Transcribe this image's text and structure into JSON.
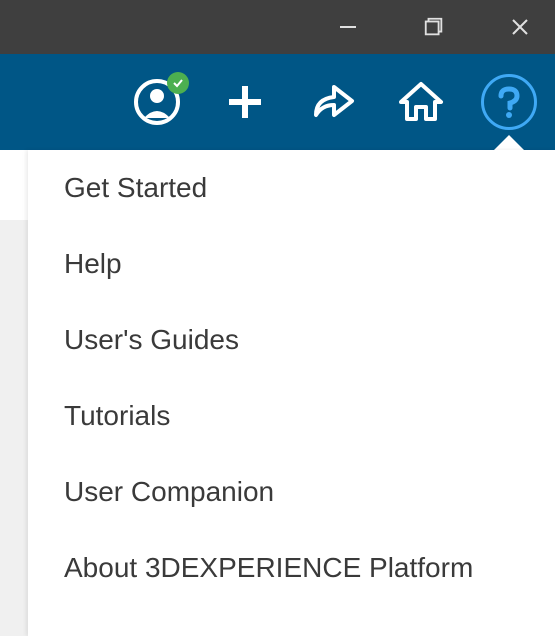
{
  "window_controls": {
    "minimize": "minimize",
    "maximize": "maximize",
    "close": "close"
  },
  "toolbar": {
    "icons": {
      "profile": "profile-icon",
      "status": "online",
      "add": "plus-icon",
      "share": "share-icon",
      "home": "home-icon",
      "help": "help-icon"
    }
  },
  "help_menu": {
    "items": [
      {
        "label": "Get Started"
      },
      {
        "label": "Help"
      },
      {
        "label": "User's Guides"
      },
      {
        "label": "Tutorials"
      },
      {
        "label": "User Companion"
      },
      {
        "label": "About 3DEXPERIENCE Platform"
      }
    ]
  },
  "colors": {
    "titlebar": "#3f3f3f",
    "toolbar": "#005686",
    "status_online": "#4caf50",
    "help_highlight": "#3fa9f5"
  }
}
